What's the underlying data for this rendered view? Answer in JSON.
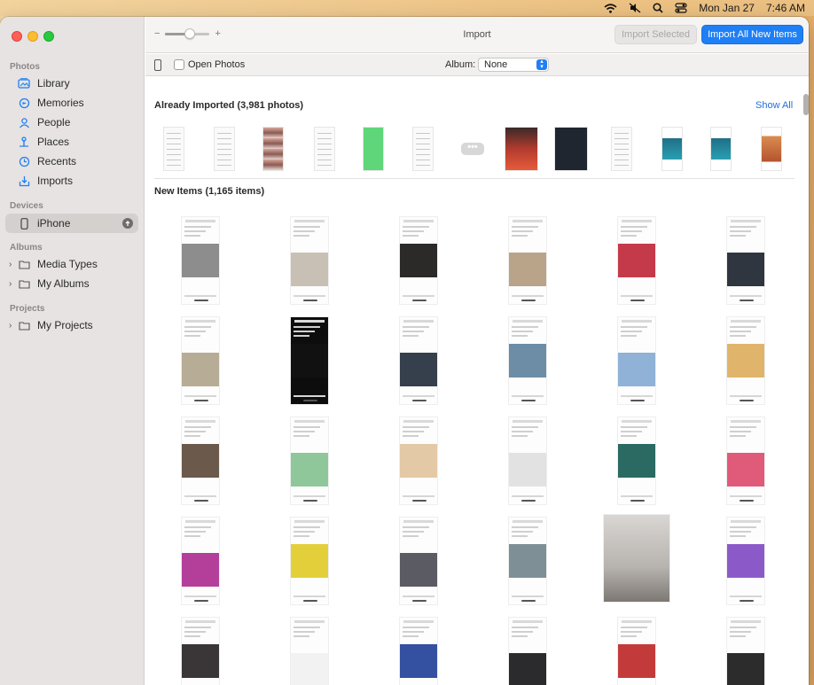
{
  "menubar": {
    "date": "Mon Jan 27",
    "time": "7:46 AM",
    "icons": [
      "wifi-icon",
      "mute-icon",
      "search-icon",
      "control-center-icon"
    ]
  },
  "window": {
    "title": "Import",
    "traffic_lights": [
      "close",
      "minimize",
      "zoom"
    ]
  },
  "colors": {
    "accent": "#1f7ff5",
    "sidebar_bg": "#e6e3e2",
    "link": "#1f6fe0"
  },
  "sidebar": {
    "sections": [
      {
        "label": "Photos",
        "items": [
          {
            "label": "Library",
            "icon": "photo-library-icon"
          },
          {
            "label": "Memories",
            "icon": "memories-icon"
          },
          {
            "label": "People",
            "icon": "people-icon"
          },
          {
            "label": "Places",
            "icon": "places-pin-icon"
          },
          {
            "label": "Recents",
            "icon": "clock-icon"
          },
          {
            "label": "Imports",
            "icon": "import-tray-icon"
          }
        ]
      },
      {
        "label": "Devices",
        "items": [
          {
            "label": "iPhone",
            "icon": "iphone-icon",
            "selected": true,
            "badge": "cloud-upload-icon"
          }
        ]
      },
      {
        "label": "Albums",
        "items": [
          {
            "label": "Media Types",
            "icon": "folder-icon",
            "disclosure": true
          },
          {
            "label": "My Albums",
            "icon": "folder-icon",
            "disclosure": true
          }
        ]
      },
      {
        "label": "Projects",
        "items": [
          {
            "label": "My Projects",
            "icon": "folder-icon",
            "disclosure": true
          }
        ]
      }
    ]
  },
  "toolbar": {
    "zoom_minus": "−",
    "zoom_plus": "+",
    "zoom_level": 0.55,
    "import_selected_label": "Import Selected",
    "import_all_label": "Import All New Items"
  },
  "options": {
    "open_photos_label": "Open Photos",
    "open_photos_checked": false,
    "album_label": "Album:",
    "album_value": "None"
  },
  "content": {
    "already_imported_title": "Already Imported (3,981 photos)",
    "show_all_label": "Show All",
    "more_label": "•••",
    "new_items_title": "New Items (1,165 items)"
  }
}
